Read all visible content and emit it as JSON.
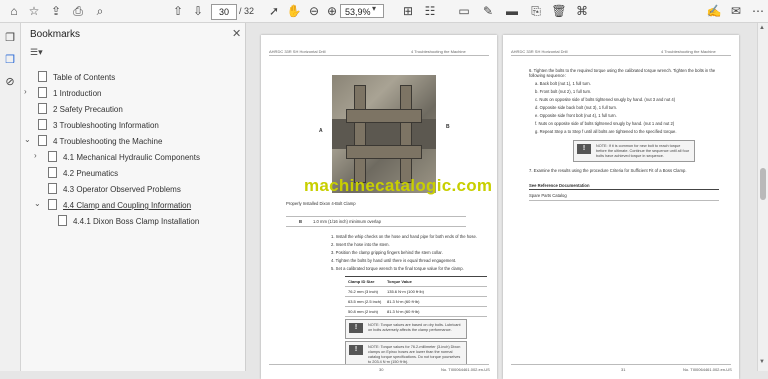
{
  "toolbar": {
    "page_current": "30",
    "page_total": "/ 32",
    "zoom": "53,9%",
    "icons": [
      "home-icon",
      "star-icon",
      "upload-icon",
      "print-icon",
      "search-icon",
      "arrow-up-icon",
      "arrow-down-icon",
      "pointer-icon",
      "hand-icon",
      "zoom-out-icon",
      "zoom-in-icon",
      "fit-page-icon",
      "scroll-mode-icon",
      "comment-icon",
      "pen-icon",
      "highlight-icon",
      "stamp-icon",
      "delete-icon",
      "attach-icon",
      "sign-icon",
      "share-icon",
      "more-icon"
    ]
  },
  "panel": {
    "title": "Bookmarks",
    "bookmarks": [
      {
        "label": "Table of Contents"
      },
      {
        "label": "1 Introduction",
        "chev": "›"
      },
      {
        "label": "2 Safety Precaution"
      },
      {
        "label": "3 Troubleshooting Information"
      },
      {
        "label": "4 Troubleshooting the Machine",
        "chev": "⌄"
      },
      {
        "label": "4.1 Mechanical Hydraulic Components",
        "chev": "›"
      },
      {
        "label": "4.2 Pneumatics"
      },
      {
        "label": "4.3 Operator Observed Problems"
      },
      {
        "label": "4.4 Clamp and Coupling Information",
        "chev": "⌄"
      },
      {
        "label": "4.4.1 Dixon Boss Clamp Installation"
      }
    ]
  },
  "left_page": {
    "header_left": "AHRDC 33R SH Horizontal Drill",
    "header_right": "4 Troubleshooting the Machine",
    "label_a": "A",
    "label_b": "B",
    "caption": "Properly Installed Dixon 4-Bolt Clamp",
    "spec_letter": "B",
    "spec_text": "1.0 mm (1/16 inch) minimum overlap",
    "steps": [
      "1.  Install the whip checks on the hose and hand pipe for both ends of the hose.",
      "2.  Insert the hose into the stem.",
      "3.  Position the clamp gripping fingers behind the stem collar.",
      "4.  Tighten the bolts by hand until there is equal thread engagement.",
      "5.  Set a calibrated torque wrench to the final torque value for the clamp."
    ],
    "table_headers": [
      "Clamp ID Size",
      "Torque Value"
    ],
    "table_rows": [
      [
        "76.2 mm (3 inch)",
        "135.6 N·m (100 ft·lb)"
      ],
      [
        "63.5 mm (2.5 inch)",
        "81.3 N·m (60 ft·lb)"
      ],
      [
        "50.8 mm (2 inch)",
        "81.3 N·m (60 ft·lb)"
      ]
    ],
    "note1": "NOTE: Torque values are based on dry bolts. Lubricant on bolts adversely affects the clamp performance.",
    "note2": "NOTE: Torque values for 76.2-millimeter (3-inch) Dixon clamps on Epiroc hoses are lower than the normal catalog torque specifications. Do not torque yourselves to 203.4 N·m (150 ft·lb).",
    "footer_left": "30",
    "footer_right": "No. TI00064461.002.en-US"
  },
  "right_page": {
    "header_left": "AHRDC 33R SH Horizontal Drill",
    "header_right": "4 Troubleshooting the Machine",
    "step6": "6.  Tighten the bolts to the required torque using the calibrated torque wrench. Tighten the bolts in the following sequence:",
    "substeps": [
      "a.  Back bolt (nut 1), 1 full turn.",
      "b.  Front bolt (nut 2), 1 full turn.",
      "c.  Nuts on opposite side of bolts tightened snugly by hand. (nut 3 and nut 4)",
      "d.  Opposite side back bolt (nut 3), 1 full turn.",
      "e.  Opposite side front bolt (nut 4), 1 full turn.",
      "f.   Nuts on opposite side of bolts tightened snugly by hand. (nut 1 and nut 2)",
      "g.  Repeat Step a to Step f until all bolts are tightened to the specified torque."
    ],
    "note3": "NOTE: If it is common for new bolt to reach torque before the ultimate. Continue the sequence until all four bolts have achieved torque in sequence.",
    "step7": "7.  Examine the results using the procedure Criteria for Sufficient Fit of a Boss Clamp.",
    "ref_title": "See Reference Documentation",
    "ref_item": "Spare Parts Catalog",
    "footer_left": "31",
    "footer_right": "No. TI00064461.002.en-US"
  },
  "watermark": "machinecatalogic.com"
}
